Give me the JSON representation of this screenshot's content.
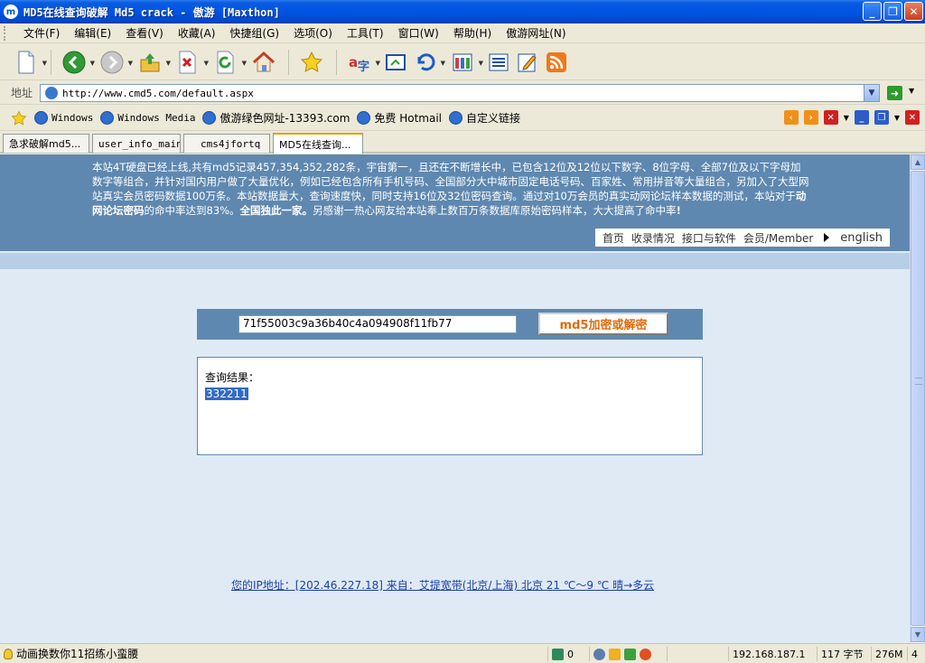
{
  "window": {
    "title": "MD5在线查询破解 Md5 crack - 傲游 [Maxthon]",
    "app_icon": "m"
  },
  "menu": [
    "文件(F)",
    "编辑(E)",
    "查看(V)",
    "收藏(A)",
    "快捷组(G)",
    "选项(O)",
    "工具(T)",
    "窗口(W)",
    "帮助(H)",
    "傲游网址(N)"
  ],
  "address": {
    "label": "地址",
    "url": "http://www.cmd5.com/default.aspx"
  },
  "favorites": [
    {
      "label": "Windows",
      "mono": true
    },
    {
      "label": "Windows Media",
      "mono": true
    },
    {
      "label": "傲游绿色网址-13393.com",
      "mono": false
    },
    {
      "label": "免费 Hotmail",
      "mono": false
    },
    {
      "label": "自定义链接",
      "mono": false
    }
  ],
  "tabs": [
    "急求破解md5...",
    "user_info_main",
    "cms4jfortq",
    "MD5在线查询..."
  ],
  "page": {
    "notice_part1": "本站4T硬盘已经上线,共有md5记录457,354,352,282条，宇宙第一，且还在不断增长中，已包含12位及12位以下数字、8位字母、全部7位及以下字母加数字等组合，并针对国内用户做了大量优化，例如已经包含所有手机号码、全国部分大中城市固定电话号码、百家姓、常用拼音等大量组合，另加入了大型网站真实会员密码数据100万条。本站数据量大，查询速度快，同时支持16位及32位密码查询。通过对10万会员的真实动网论坛样本数据的测试，本站对于",
    "notice_bold1": "动网论坛密码",
    "notice_part2": "的命中率达到83%。",
    "notice_bold2": "全国独此一家。",
    "notice_part3": "另感谢一热心网友给本站奉上数百万条数据库原始密码样本，大大提高了命中率",
    "notice_bold3": "!",
    "nav": {
      "home": "首页",
      "records": "收录情况",
      "api": "接口与软件",
      "member": "会员/Member",
      "english": "english"
    },
    "hash_value": "71f55003c9a36b40c4a094908f11fb77",
    "submit_label": "md5加密或解密",
    "result_label": "查询结果：",
    "result_value": "332211",
    "ip_info": "您的IP地址：[202.46.227.18] 来自：艾提宽带(北京/上海) 北京  21 ℃～9 ℃ 晴→多云"
  },
  "status": {
    "text": "动画换数你11招练小蛮腰",
    "count": "0",
    "ip": "192.168.187.1",
    "bytes": "117 字节",
    "mem": "276M",
    "num": "4"
  },
  "colors": {
    "banner": "#5f88b0",
    "content_bg": "#dfeaf5",
    "submit_text": "#e26b0a",
    "link": "#1a3fa8"
  }
}
